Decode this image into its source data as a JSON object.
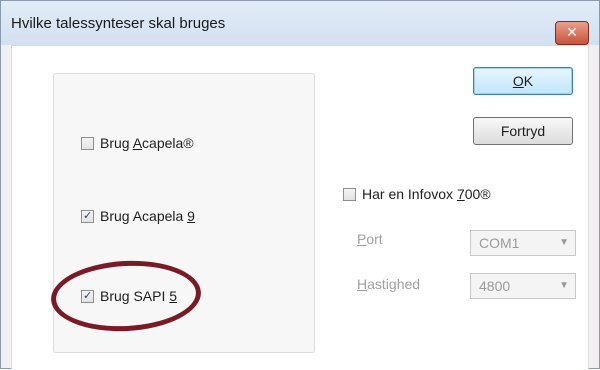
{
  "window": {
    "title": "Hvilke talessynteser skal bruges",
    "close_label": "✕"
  },
  "options": {
    "acapela": {
      "prefix": "Brug ",
      "mnemonic": "A",
      "suffix": "capela®",
      "checked": false
    },
    "acapela9": {
      "prefix": "Brug Acapela ",
      "mnemonic": "9",
      "suffix": "",
      "checked": true
    },
    "sapi5": {
      "prefix": "Brug SAPI ",
      "mnemonic": "5",
      "suffix": "",
      "checked": true
    }
  },
  "buttons": {
    "ok_mnemonic": "O",
    "ok_rest": "K",
    "cancel": "Fortryd"
  },
  "infovox": {
    "prefix": "Har en Infovox ",
    "mnemonic": "7",
    "suffix": "00®",
    "checked": false
  },
  "port": {
    "label_mnemonic": "P",
    "label_rest": "ort",
    "value": "COM1"
  },
  "speed": {
    "label_mnemonic": "H",
    "label_rest": "astighed",
    "value": "4800"
  },
  "colors": {
    "annotation_ring": "#7a1a24",
    "close_button": "#c9523a"
  }
}
